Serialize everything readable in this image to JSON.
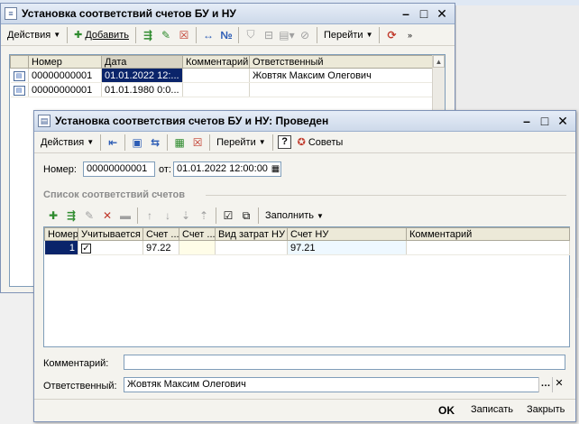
{
  "window_list": {
    "title": "Установка соответствий счетов БУ и НУ",
    "toolbar": {
      "actions_label": "Действия",
      "add_label": "Добавить",
      "goto_label": "Перейти"
    },
    "columns": [
      "Номер",
      "Дата",
      "Комментарий",
      "Ответственный"
    ],
    "rows": [
      {
        "number": "00000000001",
        "date": "01.01.2022 12:...",
        "comment": "",
        "responsible": "Жовтяк Максим Олегович"
      },
      {
        "number": "00000000001",
        "date": "01.01.1980 0:0...",
        "comment": "",
        "responsible": ""
      }
    ]
  },
  "window_doc": {
    "title": "Установка соответствия счетов БУ и НУ: Проведен",
    "toolbar": {
      "actions_label": "Действия",
      "goto_label": "Перейти",
      "help_label": "?",
      "tips_label": "Советы"
    },
    "number_label": "Номер:",
    "number_value": "00000000001",
    "date_label": "от:",
    "date_value": "01.01.2022 12:00:00",
    "section_title": "Список соответствий счетов",
    "fill_label": "Заполнить",
    "columns": [
      "Номер",
      "Учитывается",
      "Счет ...",
      "Счет ...",
      "Вид затрат НУ",
      "Счет НУ",
      "Комментарий"
    ],
    "rows": [
      {
        "number": "1",
        "counted": true,
        "account_bu": "97.22",
        "account2": "",
        "cost_type": "",
        "account_nu": "97.21",
        "comment": ""
      }
    ],
    "comment_label": "Комментарий:",
    "comment_value": "",
    "responsible_label": "Ответственный:",
    "responsible_value": "Жовтяк Максим Олегович",
    "buttons": {
      "ok": "OK",
      "save": "Записать",
      "close": "Закрыть"
    }
  },
  "colors": {
    "selection": "#0a246a",
    "title_gradient_top": "#e6edf7",
    "title_gradient_bottom": "#cdd9ea"
  }
}
